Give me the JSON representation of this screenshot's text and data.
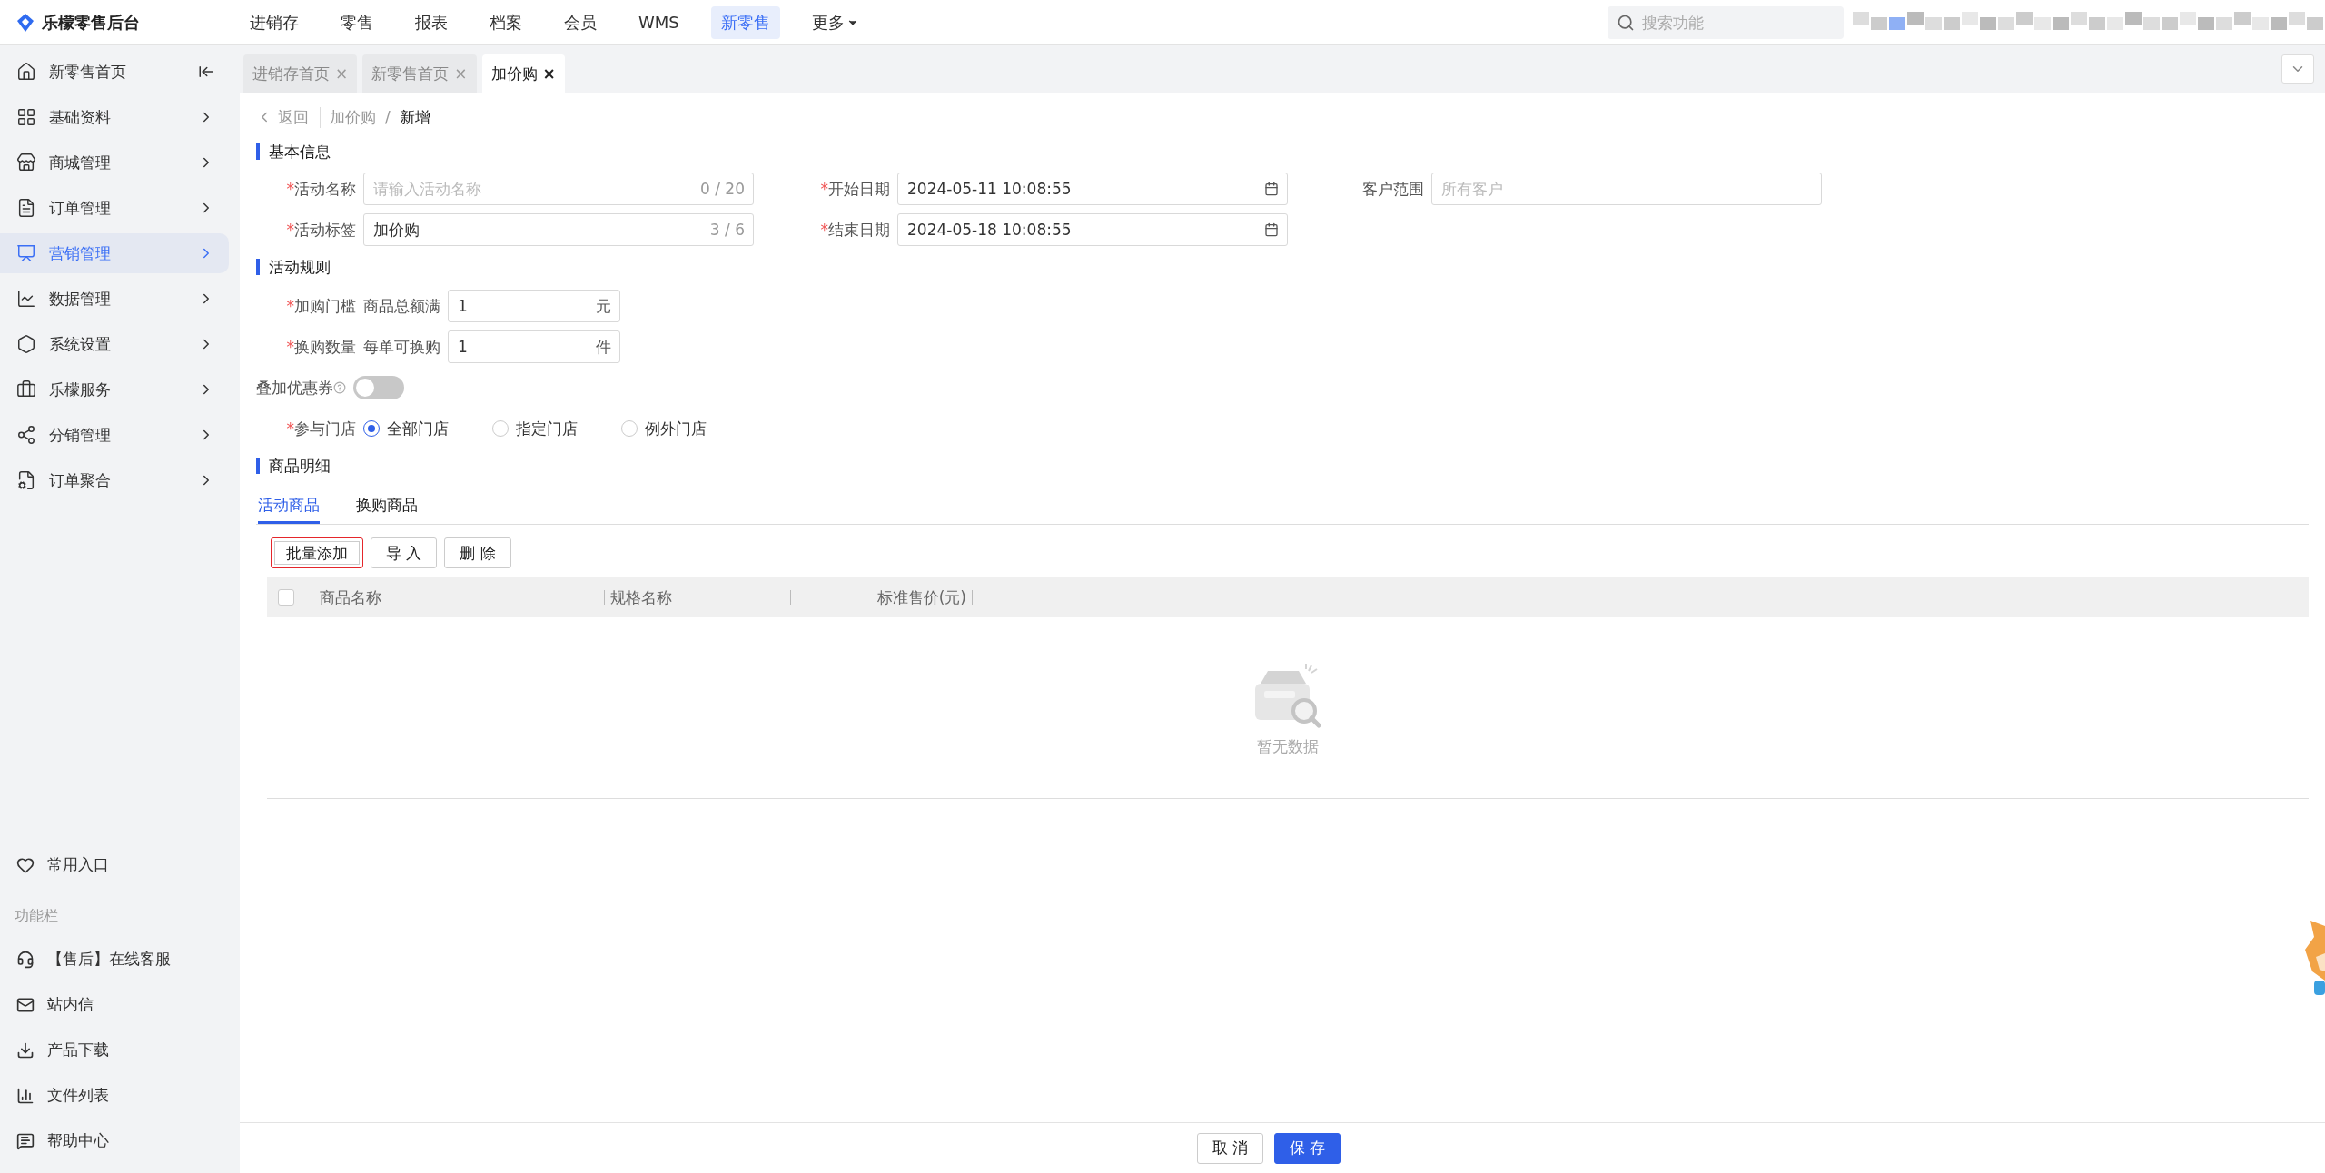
{
  "topbar": {
    "brand": "乐檬零售后台",
    "nav": [
      {
        "label": "进销存",
        "selected": false
      },
      {
        "label": "零售",
        "selected": false
      },
      {
        "label": "报表",
        "selected": false
      },
      {
        "label": "档案",
        "selected": false
      },
      {
        "label": "会员",
        "selected": false
      },
      {
        "label": "WMS",
        "selected": false
      },
      {
        "label": "新零售",
        "selected": true
      }
    ],
    "more": "更多",
    "search_placeholder": "搜索功能"
  },
  "page_tabs": [
    {
      "label": "进销存首页",
      "selected": false,
      "close": "×"
    },
    {
      "label": "新零售首页",
      "selected": false,
      "close": "×"
    },
    {
      "label": "加价购",
      "selected": true,
      "close": "×"
    }
  ],
  "sidebar": {
    "items": [
      {
        "label": "新零售首页",
        "kind": "home",
        "selected": false
      },
      {
        "label": "基础资料",
        "kind": "menu",
        "selected": false
      },
      {
        "label": "商城管理",
        "kind": "menu",
        "selected": false
      },
      {
        "label": "订单管理",
        "kind": "menu",
        "selected": false
      },
      {
        "label": "营销管理",
        "kind": "menu",
        "selected": true
      },
      {
        "label": "数据管理",
        "kind": "menu",
        "selected": false
      },
      {
        "label": "系统设置",
        "kind": "menu",
        "selected": false
      },
      {
        "label": "乐檬服务",
        "kind": "menu",
        "selected": false
      },
      {
        "label": "分销管理",
        "kind": "menu",
        "selected": false
      },
      {
        "label": "订单聚合",
        "kind": "menu",
        "selected": false
      }
    ],
    "favorites": "常用入口",
    "tools_title": "功能栏",
    "tools": [
      "【售后】在线客服",
      "站内信",
      "产品下载",
      "文件列表",
      "帮助中心"
    ]
  },
  "breadcrumb": {
    "back": "返回",
    "path": [
      "加价购",
      "新增"
    ],
    "separator": "/"
  },
  "required_mark": "*",
  "basic_info": {
    "title": "基本信息",
    "fields": [
      {
        "label": "活动名称",
        "required": true,
        "kind": "text",
        "placeholder": "请输入活动名称",
        "counter": "0 / 20"
      },
      {
        "label": "开始日期",
        "required": true,
        "kind": "date",
        "value": "2024-05-11 10:08:55"
      },
      {
        "label": "客户范围",
        "required": false,
        "kind": "text",
        "placeholder": "所有客户"
      },
      {
        "label": "活动标签",
        "required": true,
        "kind": "text",
        "value": "加价购",
        "counter": "3 / 6"
      },
      {
        "label": "结束日期",
        "required": true,
        "kind": "date",
        "value": "2024-05-18 10:08:55"
      }
    ]
  },
  "rules": {
    "title": "活动规则",
    "rows": [
      {
        "label": "加购门槛",
        "required": true,
        "prefix": "商品总额满",
        "value": "1",
        "unit": "元"
      },
      {
        "label": "换购数量",
        "required": true,
        "prefix": "每单可换购",
        "value": "1",
        "unit": "件"
      }
    ],
    "coupon_toggle": {
      "label": "叠加优惠券",
      "on": false
    },
    "stores": {
      "label": "参与门店",
      "required": true,
      "options": [
        {
          "label": "全部门店",
          "selected": true
        },
        {
          "label": "指定门店",
          "selected": false
        },
        {
          "label": "例外门店",
          "selected": false
        }
      ]
    }
  },
  "goods": {
    "title": "商品明细",
    "tabs": [
      {
        "label": "活动商品",
        "selected": true
      },
      {
        "label": "换购商品",
        "selected": false
      }
    ],
    "buttons": [
      {
        "label": "批量添加",
        "highlighted": true
      },
      {
        "label": "导 入",
        "highlighted": false
      },
      {
        "label": "删 除",
        "highlighted": false
      }
    ],
    "select_all_checked": false,
    "columns": [
      "商品名称",
      "规格名称",
      "标准售价(元)"
    ],
    "empty_text": "暂无数据"
  },
  "footer_buttons": [
    {
      "label": "取 消",
      "kind": "default"
    },
    {
      "label": "保 存",
      "kind": "primary"
    }
  ]
}
